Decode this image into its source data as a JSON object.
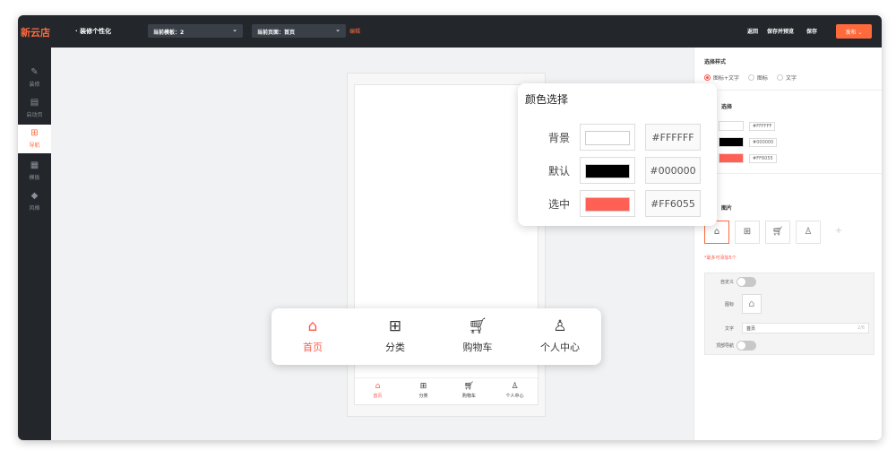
{
  "topbar": {
    "logo": "新云店",
    "section_title": "· 装修个性化",
    "template_select": "当前模板：2",
    "page_select": "当前页面：首页",
    "edit_link": "编辑",
    "back": "返回",
    "save_preview": "保存并预览",
    "save": "保存",
    "publish": "发布 ⌄"
  },
  "sidebar": {
    "items": [
      {
        "icon": "brush-icon",
        "glyph": "✎",
        "label": "装修"
      },
      {
        "icon": "launch-page-icon",
        "glyph": "▤",
        "label": "启动页"
      },
      {
        "icon": "grid-icon",
        "glyph": "⊞",
        "label": "导航"
      },
      {
        "icon": "template-icon",
        "glyph": "▦",
        "label": "模板"
      },
      {
        "icon": "style-icon",
        "glyph": "◆",
        "label": "风格"
      }
    ]
  },
  "mini_nav": {
    "items": [
      {
        "icon": "home-icon",
        "glyph": "⌂",
        "label": "首页"
      },
      {
        "icon": "category-icon",
        "glyph": "⊞",
        "label": "分类"
      },
      {
        "icon": "cart-icon",
        "glyph": "🛒︎",
        "label": "购物车"
      },
      {
        "icon": "user-icon",
        "glyph": "♙",
        "label": "个人中心"
      }
    ]
  },
  "right_panel": {
    "style_title": "选择样式",
    "style_options": [
      "图标+文字",
      "图标",
      "文字"
    ],
    "color_title": "选择",
    "colors": [
      {
        "label": "背景",
        "hex": "#FFFFFF"
      },
      {
        "label": "默认",
        "hex": "#000000"
      },
      {
        "label": "选中",
        "hex": "#FF6055"
      }
    ],
    "image_title": "图片",
    "hint": "*最多可添加5个",
    "custom_label": "自定义",
    "icon_label": "图标",
    "text_label": "文字",
    "text_value": "首页",
    "text_count": "2/6",
    "top_nav_label": "顶部导航"
  },
  "color_popup": {
    "title": "颜色选择",
    "rows": [
      {
        "label": "背景",
        "hex": "#FFFFFF"
      },
      {
        "label": "默认",
        "hex": "#000000"
      },
      {
        "label": "选中",
        "hex": "#FF6055"
      }
    ]
  },
  "tab_popup": {
    "items": [
      {
        "icon": "home-icon",
        "glyph": "⌂",
        "label": "首页"
      },
      {
        "icon": "category-icon",
        "glyph": "⊞",
        "label": "分类"
      },
      {
        "icon": "cart-icon",
        "glyph": "🛒︎",
        "label": "购物车"
      },
      {
        "icon": "user-icon",
        "glyph": "♙",
        "label": "个人中心"
      }
    ]
  },
  "colors": {
    "accent": "#ff6a3d",
    "selected": "#FF6055",
    "topbar": "#23272b"
  }
}
